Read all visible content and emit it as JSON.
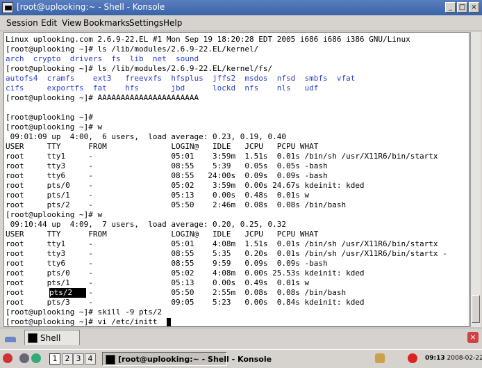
{
  "window": {
    "title": "[root@uplooking:~ - Shell - Konsole"
  },
  "menu": [
    "Session",
    "Edit",
    "View",
    "Bookmarks",
    "Settings",
    "Help"
  ],
  "terminal": {
    "lines": [
      "Linux uplooking.com 2.6.9-22.EL #1 Mon Sep 19 18:20:28 EDT 2005 i686 i686 i386 GNU/Linux",
      "[root@uplooking ~]# ls /lib/modules/2.6.9-22.EL/kernel/",
      "",
      "[root@uplooking ~]# ls /lib/modules/2.6.9-22.EL/kernel/fs/",
      "",
      "",
      "[root@uplooking ~]# AAAAAAAAAAAAAAAAAAAAAA",
      "",
      "[root@uplooking ~]#",
      "[root@uplooking ~]# w",
      " 09:01:09 up  4:00,  6 users,  load average: 0.23, 0.19, 0.40",
      "USER     TTY      FROM              LOGIN@   IDLE   JCPU   PCPU WHAT",
      "root     tty1     -                 05:01    3:59m  1.51s  0.01s /bin/sh /usr/X11R6/bin/startx",
      "root     tty3     -                 08:55    5:39   0.05s  0.05s -bash",
      "root     tty6     -                 08:55   24:00s  0.09s  0.09s -bash",
      "root     pts/0    -                 05:02    3:59m  0.00s 24.67s kdeinit: kded",
      "root     pts/1    -                 05:13    0.00s  0.48s  0.01s w",
      "root     pts/2    -                 05:50    2:46m  0.08s  0.08s /bin/bash",
      "[root@uplooking ~]# w",
      " 09:10:44 up  4:09,  7 users,  load average: 0.20, 0.25, 0.32",
      "USER     TTY      FROM              LOGIN@   IDLE   JCPU   PCPU WHAT",
      "root     tty1     -                 05:01    4:08m  1.51s  0.01s /bin/sh /usr/X11R6/bin/startx",
      "root     tty3     -                 08:55    5:35   0.20s  0.01s /bin/sh /usr/X11R6/bin/startx -",
      "root     tty6     -                 08:55    9:59   0.09s  0.09s -bash",
      "root     pts/0    -                 05:02    4:08m  0.00s 25.53s kdeinit: kded",
      "root     pts/1    -                 05:13    0.00s  0.49s  0.01s w",
      "root              -                 05:50    2:55m  0.08s  0.08s /bin/bash",
      "root     pts/3    -                 09:05    5:23   0.00s  0.84s kdeinit: kded",
      "[root@uplooking ~]# skill -9 pts/2",
      "[root@uplooking ~]# vi /etc/initt"
    ],
    "ls_kernel": "arch  crypto  drivers  fs  lib  net  sound",
    "ls_fs_row1": "autofs4  cramfs    ext3   freevxfs  hfsplus  jffs2  msdos  nfsd  smbfs  vfat",
    "ls_fs_row2": "cifs     exportfs  fat    hfs       jbd      lockd  nfs    nls   udf",
    "highlight_text": "pts/2   "
  },
  "tabs": {
    "shell_tab": "Shell"
  },
  "taskbar": {
    "desktops": [
      "1",
      "2",
      "3",
      "4"
    ],
    "task_label": "[root@uplooking:~ - Shell - Konsole",
    "time": "09:13",
    "date": "2008-02-22"
  },
  "colors": {
    "titlebar": "#3a63a8",
    "listing_blue": "#2a3fc8"
  }
}
